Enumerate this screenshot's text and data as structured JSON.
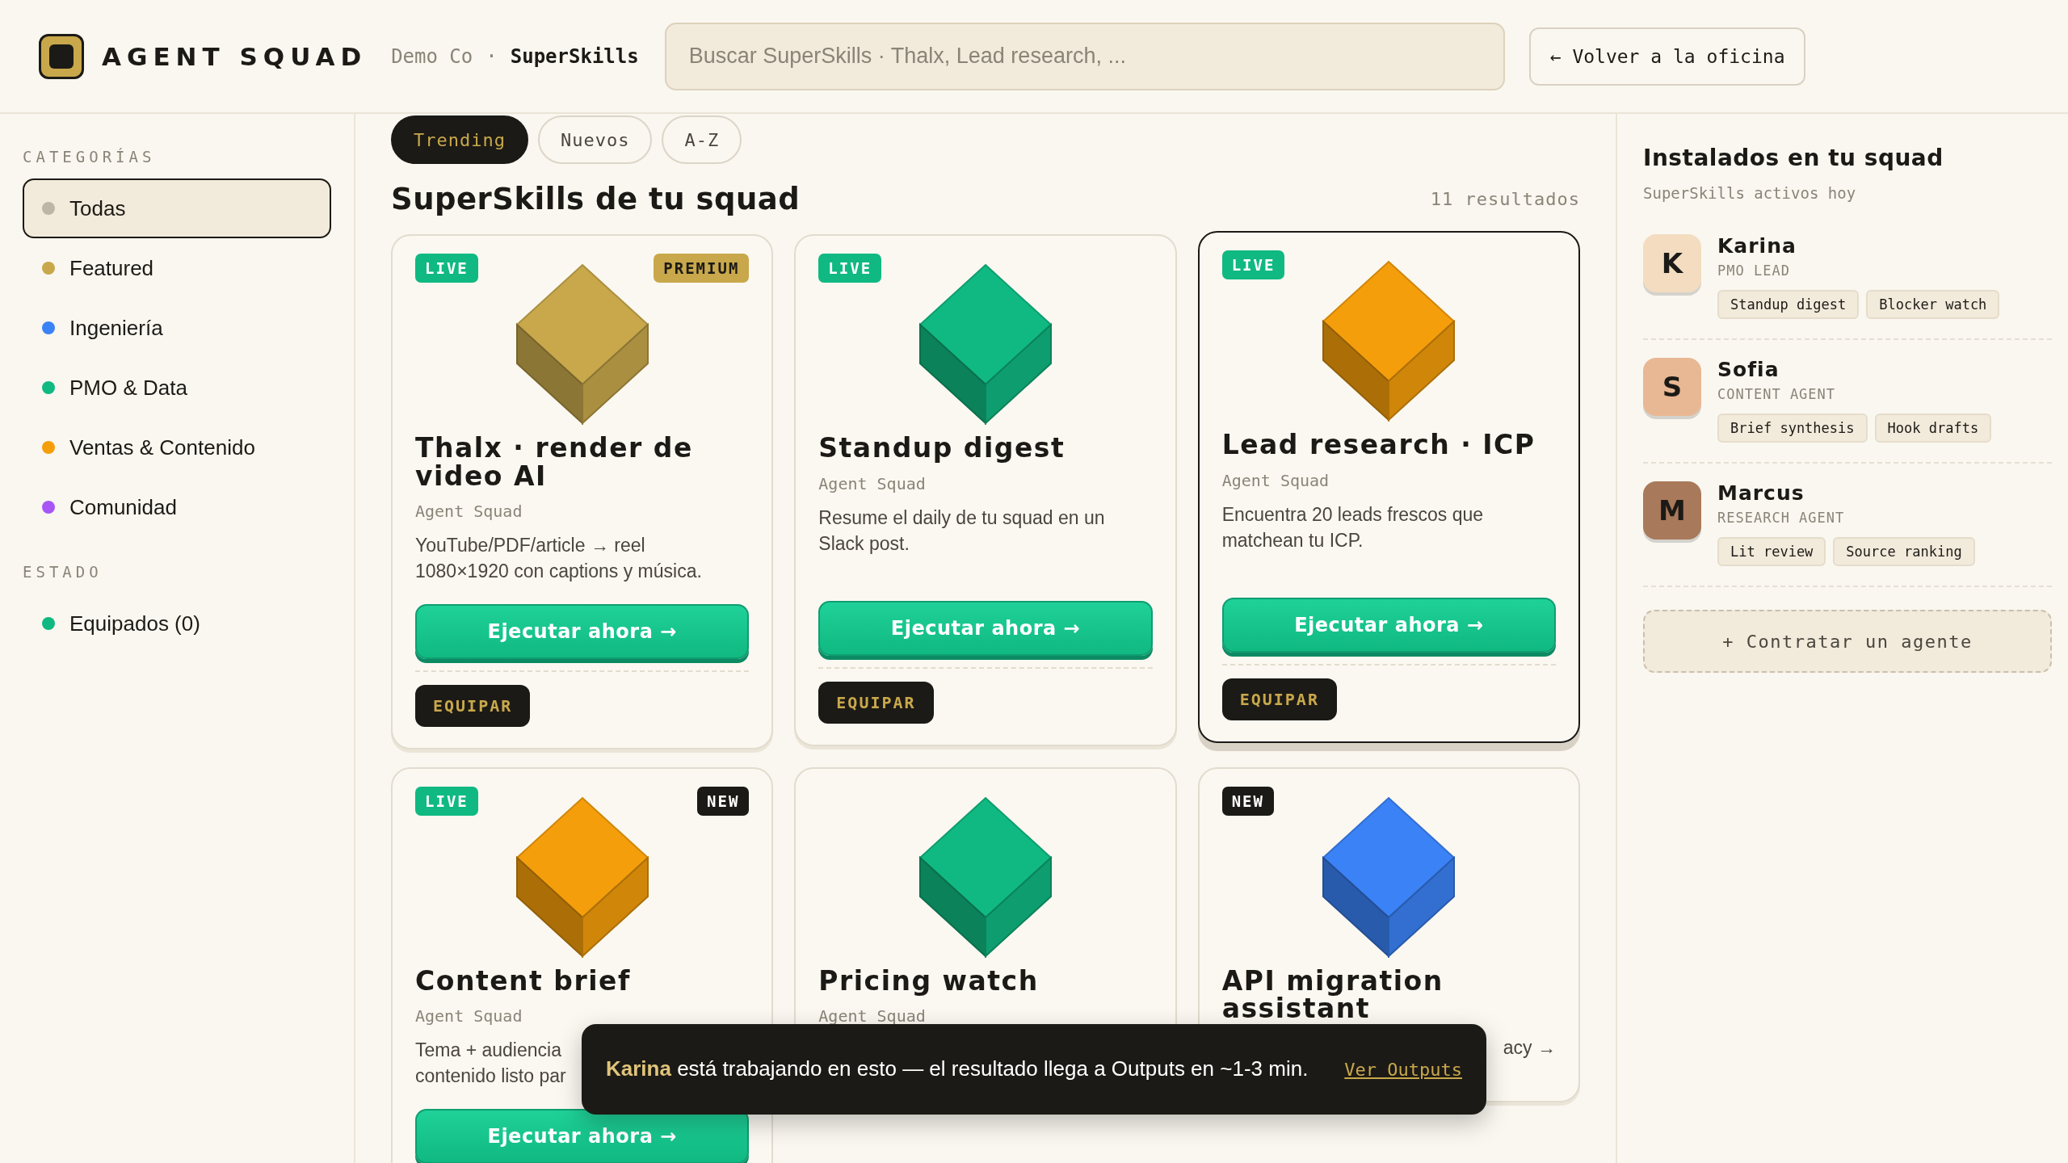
{
  "header": {
    "logo": "AGENT SQUAD",
    "breadcrumb": [
      "Demo Co",
      "SuperSkills"
    ],
    "separator": "·",
    "search": {
      "placeholder": "Buscar SuperSkills · Thalx, Lead research, ..."
    },
    "back_button": "← Volver a la oficina"
  },
  "sidebar": {
    "sections": [
      {
        "heading": "CATEGORÍAS",
        "items": [
          {
            "label": "Todas",
            "color": "#bdb5a6",
            "selected": true
          },
          {
            "label": "Featured",
            "color": "#c8a84b",
            "selected": false
          },
          {
            "label": "Ingeniería",
            "color": "#3b82f6",
            "selected": false
          },
          {
            "label": "PMO & Data",
            "color": "#10b981",
            "selected": false
          },
          {
            "label": "Ventas & Contenido",
            "color": "#f59e0b",
            "selected": false
          },
          {
            "label": "Comunidad",
            "color": "#a855f7",
            "selected": false
          }
        ]
      },
      {
        "heading": "ESTADO",
        "items": [
          {
            "label": "Equipados (0)",
            "color": "#10b981",
            "selected": false
          }
        ]
      }
    ]
  },
  "sort_tabs": [
    {
      "label": "Trending",
      "selected": true
    },
    {
      "label": "Nuevos",
      "selected": false
    },
    {
      "label": "A-Z",
      "selected": false
    }
  ],
  "section_title": "SuperSkills de tu squad",
  "result_count": "11 resultados",
  "cards": [
    {
      "selected": false,
      "badges": [
        {
          "label": "LIVE",
          "kind": "live"
        },
        {
          "label": "PREMIUM",
          "kind": "premium"
        }
      ],
      "color": "#c8a84b",
      "title": "Thalx · render de video AI",
      "author": "Agent Squad",
      "description": [
        {
          "text": "YouTube/PDF/article → reel"
        },
        {
          "text": "1080×1920 con captions y música."
        }
      ],
      "run_button": "Ejecutar ahora →",
      "equip_button": "EQUIPAR"
    },
    {
      "selected": false,
      "badges": [
        {
          "label": "LIVE",
          "kind": "live"
        }
      ],
      "color": "#10b981",
      "title": "Standup digest",
      "author": "Agent Squad",
      "description": [
        {
          "text": "Resume el daily de tu squad en un"
        },
        {
          "text": "Slack post."
        }
      ],
      "run_button": "Ejecutar ahora →",
      "equip_button": "EQUIPAR"
    },
    {
      "selected": true,
      "badges": [
        {
          "label": "LIVE",
          "kind": "live"
        }
      ],
      "color": "#f59e0b",
      "title": "Lead research · ICP",
      "author": "Agent Squad",
      "description": [
        {
          "text": "Encuentra 20 leads frescos que"
        },
        {
          "text": "matchean tu ICP."
        }
      ],
      "run_button": "Ejecutar ahora →",
      "equip_button": "EQUIPAR"
    },
    {
      "selected": false,
      "badges": [
        {
          "label": "LIVE",
          "kind": "live"
        },
        {
          "label": "NEW",
          "kind": "new"
        }
      ],
      "color": "#f59e0b",
      "title": "Content brief",
      "author": "Agent Squad",
      "description": [
        {
          "text": "Tema + audiencia"
        },
        {
          "text": "contenido listo par"
        }
      ],
      "run_button": "Ejecutar ahora →"
    },
    {
      "selected": false,
      "color": "#10b981",
      "title": "Pricing watch",
      "author": "Agent Squad"
    },
    {
      "selected": false,
      "badges": [
        {
          "label": "NEW",
          "kind": "new"
        }
      ],
      "color": "#3b82f6",
      "title": "API migration assistant",
      "description": [
        {
          "text": "acy →",
          "kind": "tail"
        }
      ]
    }
  ],
  "installed": {
    "title": "Instalados en tu squad",
    "subtitle": "SuperSkills activos hoy",
    "agents": [
      {
        "initial": "K",
        "name": "Karina",
        "role": "PMO LEAD",
        "color": "#f3dcc0",
        "skills": [
          "Standup digest",
          "Blocker watch"
        ]
      },
      {
        "initial": "S",
        "name": "Sofia",
        "role": "CONTENT AGENT",
        "color": "#e8b894",
        "skills": [
          "Brief synthesis",
          "Hook drafts"
        ]
      },
      {
        "initial": "M",
        "name": "Marcus",
        "role": "RESEARCH AGENT",
        "color": "#a8795a",
        "skills": [
          "Lit review",
          "Source ranking"
        ]
      }
    ],
    "hire_button": "+ Contratar un agente"
  },
  "toast": {
    "message": "**Karina** está trabajando en esto — el resultado llega a Outputs en ~1-3 min.",
    "link": "Ver Outputs"
  }
}
